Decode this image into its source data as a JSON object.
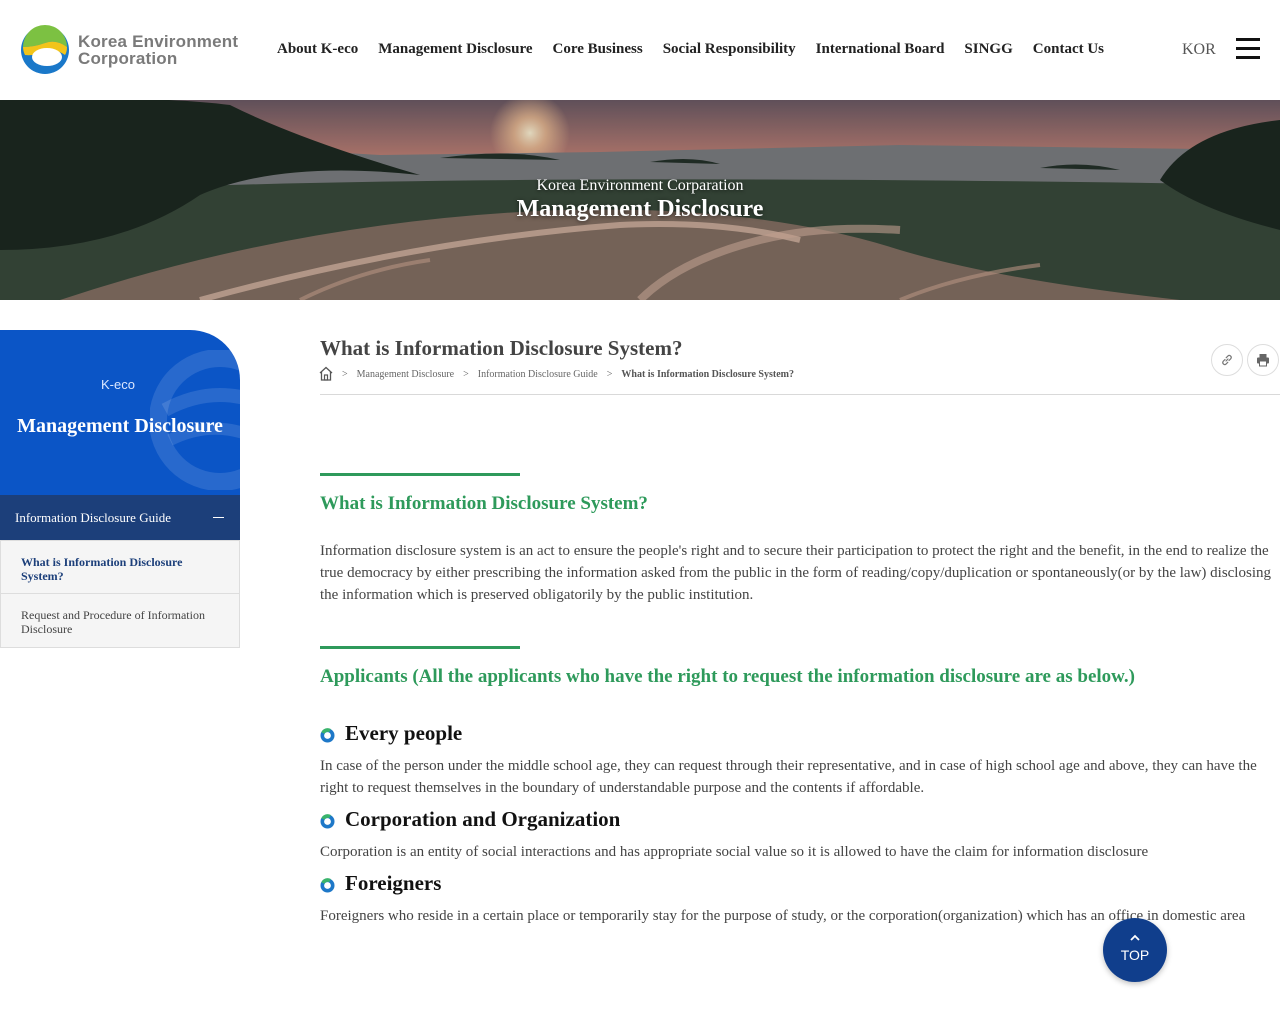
{
  "header": {
    "logo_line1": "Korea Environment",
    "logo_line2": "Corporation",
    "nav": [
      "About K-eco",
      "Management Disclosure",
      "Core Business",
      "Social Responsibility",
      "International Board",
      "SINGG",
      "Contact Us"
    ],
    "lang": "KOR"
  },
  "hero": {
    "subtitle": "Korea Environment Corparation",
    "title": "Management Disclosure"
  },
  "sidebar": {
    "brand": "K-eco",
    "title": "Management Disclosure",
    "group_label": "Information Disclosure Guide",
    "items": [
      {
        "label": "What is Information Disclosure System?",
        "active": true
      },
      {
        "label": "Request and Procedure of Information Disclosure",
        "active": false
      }
    ]
  },
  "main": {
    "page_title": "What is Information Disclosure System?",
    "breadcrumb": [
      "Management Disclosure",
      "Information Disclosure Guide",
      "What is Information Disclosure System?"
    ],
    "section1_title": "What is Information Disclosure System?",
    "section1_text": "Information disclosure system is an act to ensure the people's right and to secure their participation to protect the right and the benefit, in the end to realize the true democracy by either prescribing the information asked from the public in the form of reading/copy/duplication or spontaneously(or by the law) disclosing the information which is preserved obligatorily by the public institution.",
    "section2_title": "Applicants (All the applicants who have the right to request the information disclosure are as below.)",
    "items": [
      {
        "title": "Every people",
        "text": "In case of the person under the middle school age, they can request through their representative, and in case of high school age and above, they can have the right to request themselves in the boundary of understandable purpose and the contents if affordable."
      },
      {
        "title": "Corporation and Organization",
        "text": "Corporation is an entity of social interactions and has appropriate social value so it is allowed to have the claim for information disclosure"
      },
      {
        "title": "Foreigners",
        "text": "Foreigners who reside in a certain place or temporarily stay for the purpose of study, or the corporation(organization) which has an office in domestic area"
      }
    ]
  },
  "top_button": "TOP",
  "colors": {
    "accent_green": "#2e9a5b",
    "sidebar_blue": "#0b55c6",
    "sidebar_navy": "#1c3f7a",
    "top_button": "#103e8c"
  },
  "icons": [
    "home-icon",
    "link-icon",
    "print-icon",
    "hamburger-menu-icon",
    "arrow-up-icon",
    "bullet-ring-icon",
    "logo-mark-icon",
    "minus-icon"
  ]
}
